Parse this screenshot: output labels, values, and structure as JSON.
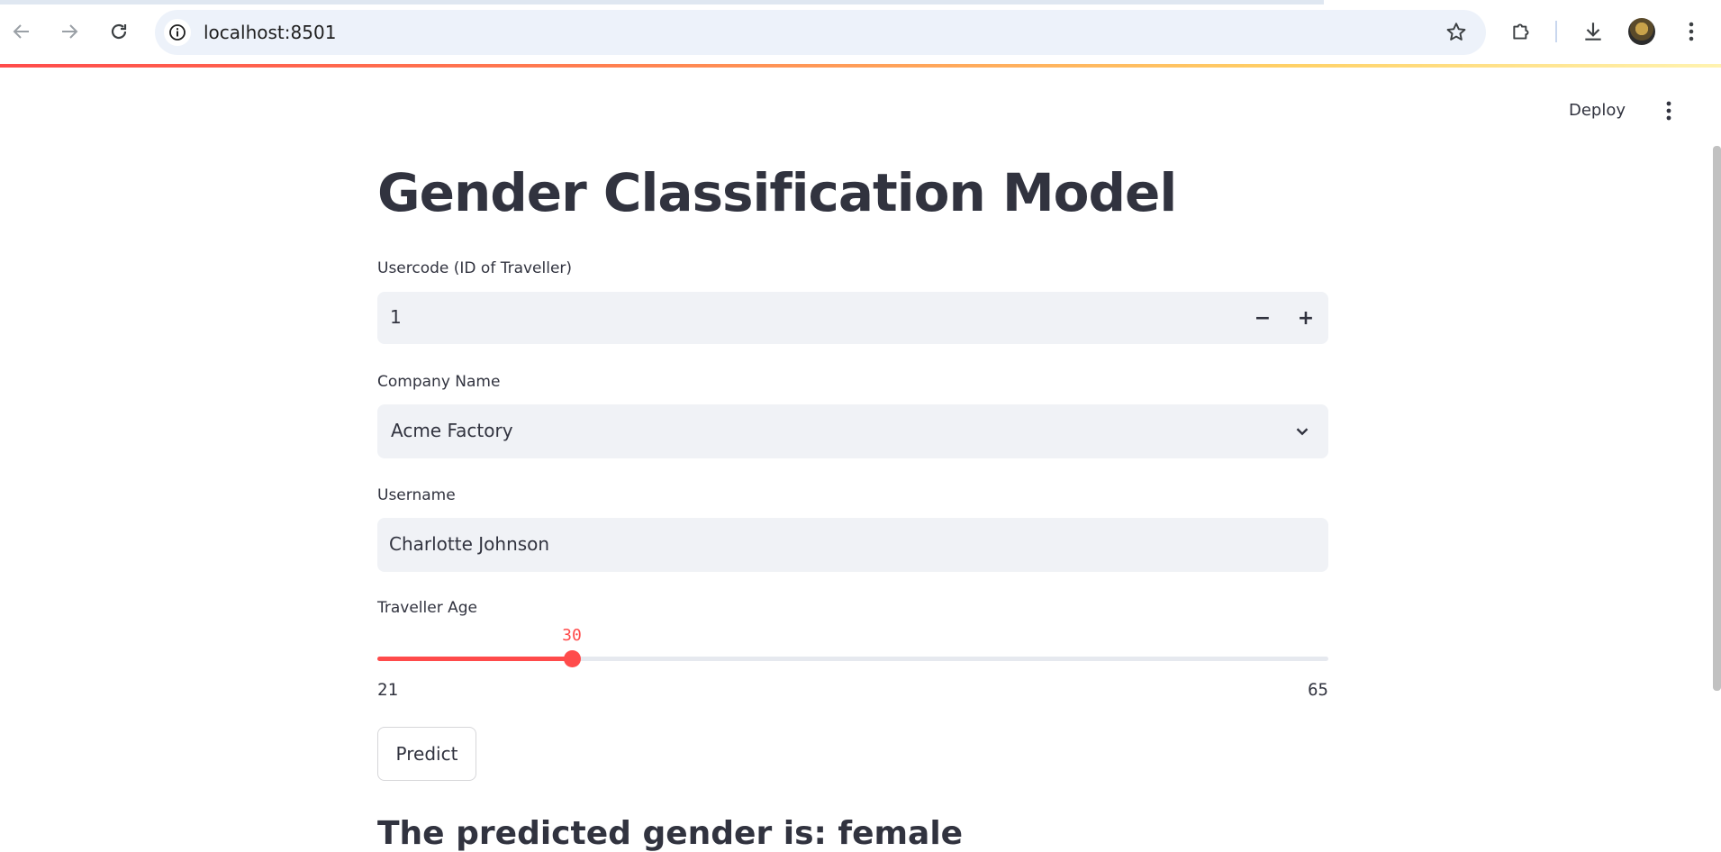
{
  "browser": {
    "url": "localhost:8501",
    "icons": {
      "back": "arrow-left-icon",
      "forward": "arrow-right-icon",
      "reload": "reload-icon",
      "site_info": "info-icon",
      "bookmark": "star-icon",
      "extensions": "puzzle-icon",
      "downloads": "download-icon",
      "profile": "avatar",
      "menu": "kebab-menu-icon"
    }
  },
  "toolbar": {
    "deploy_label": "Deploy"
  },
  "app": {
    "title": "Gender Classification Model",
    "usercode": {
      "label": "Usercode (ID of Traveller)",
      "value": "1",
      "decrement": "−",
      "increment": "+"
    },
    "company": {
      "label": "Company Name",
      "selected": "Acme Factory"
    },
    "username": {
      "label": "Username",
      "value": "Charlotte Johnson"
    },
    "age": {
      "label": "Traveller Age",
      "value": 30,
      "min": 21,
      "max": 65
    },
    "predict_label": "Predict",
    "result_text": "The predicted gender is: female"
  },
  "colors": {
    "accent": "#ff4b4b",
    "text": "#31333f",
    "input_bg": "#f0f2f6"
  }
}
